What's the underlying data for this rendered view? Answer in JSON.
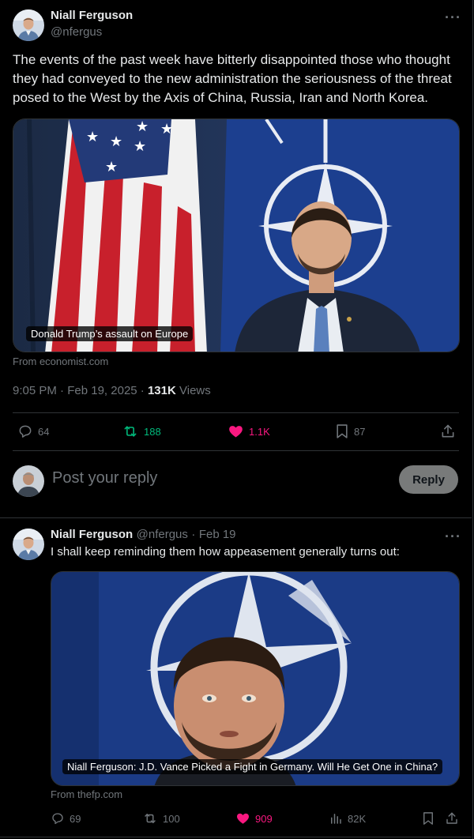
{
  "colors": {
    "background": "#000000",
    "text": "#e7e9ea",
    "muted": "#71767b",
    "retweet": "#00ba7c",
    "like": "#f91880",
    "border": "#2f3336"
  },
  "main_tweet": {
    "author_name": "Niall Ferguson",
    "author_handle": "@nfergus",
    "more_icon": "more-horizontal-icon",
    "text": "The events of the past week have bitterly disappointed those who thought they had conveyed to the new administration the seriousness of the threat posed to the West by the Axis of China, Russia, Iran and North Korea.",
    "card_caption": "Donald Trump’s assault on Europe",
    "card_source": "From economist.com",
    "time": "9:05 PM",
    "date": "Feb 19, 2025",
    "views_count": "131K",
    "views_label": "Views",
    "stats": {
      "replies": "64",
      "retweets": "188",
      "likes": "1.1K",
      "bookmarks": "87"
    }
  },
  "reply_box": {
    "placeholder": "Post your reply",
    "button_label": "Reply"
  },
  "reply_tweet": {
    "author_name": "Niall Ferguson",
    "author_handle": "@nfergus",
    "date": "Feb 19",
    "text": "I shall keep reminding them how appeasement generally turns out:",
    "card_caption": "Niall Ferguson: J.D. Vance Picked a Fight in Germany. Will He Get One in China?",
    "card_source": "From thefp.com",
    "stats": {
      "replies": "69",
      "retweets": "100",
      "likes": "909",
      "views": "82K"
    }
  }
}
